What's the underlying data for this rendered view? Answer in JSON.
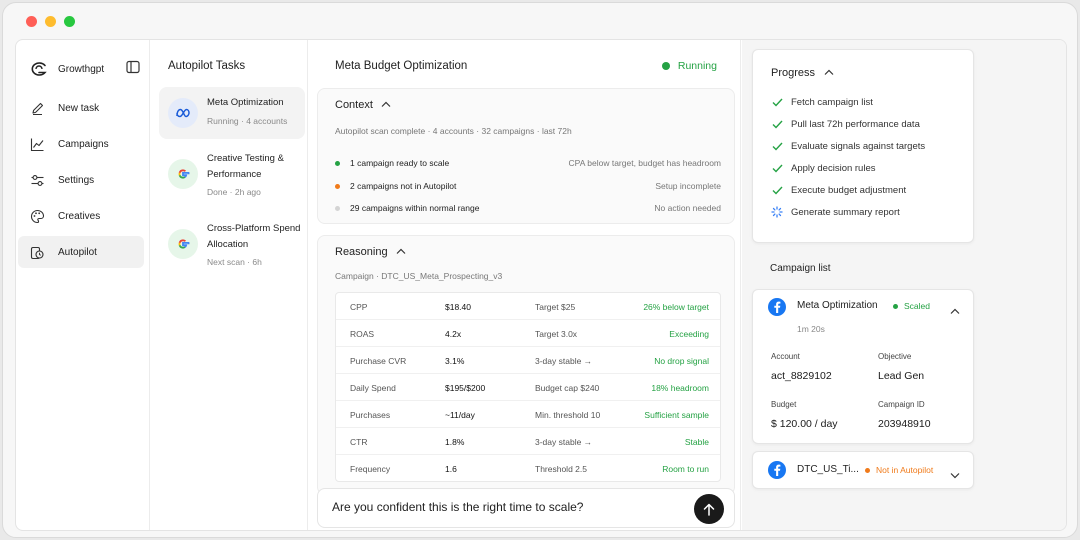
{
  "window": {
    "controls": {
      "close_color": "#ff5f57",
      "minimize_color": "#febc2e",
      "zoom_color": "#28c840"
    }
  },
  "sidebar": {
    "brand": "Growthgpt",
    "items": [
      {
        "label": "New task",
        "icon": "pen-icon"
      },
      {
        "label": "Campaigns",
        "icon": "line-chart-icon"
      },
      {
        "label": "Settings",
        "icon": "sliders-icon"
      },
      {
        "label": "Creatives",
        "icon": "palette-icon"
      },
      {
        "label": "Autopilot",
        "icon": "autopilot-icon",
        "active": true
      }
    ]
  },
  "tasks": {
    "title": "Autopilot Tasks",
    "items": [
      {
        "title": "Meta Optimization",
        "subtitle": "Running · 4 accounts",
        "icon": "meta-icon",
        "active": true
      },
      {
        "title": "Creative Testing & Performance",
        "subtitle": "Done · 2h ago",
        "icon": "google-icon"
      },
      {
        "title": "Cross-Platform Spend Allocation",
        "subtitle": "Next scan · 6h",
        "icon": "google-icon"
      }
    ]
  },
  "main": {
    "title": "Meta Budget Optimization",
    "status": "Running",
    "context": {
      "title": "Context",
      "summary": "Autopilot scan complete · 4 accounts · 32 campaigns · last 72h",
      "rows": [
        {
          "label": "1 campaign ready to scale",
          "detail": "CPA below target, budget has headroom",
          "color": "#25a244"
        },
        {
          "label": "2 campaigns not in Autopilot",
          "detail": "Setup incomplete",
          "color": "#f07a1a"
        },
        {
          "label": "29 campaigns within normal range",
          "detail": "No action needed",
          "color": "#d4d4d4"
        }
      ]
    },
    "reasoning": {
      "title": "Reasoning",
      "campaign": "Campaign · DTC_US_Meta_Prospecting_v3",
      "rows": [
        {
          "metric": "CPP",
          "value": "$18.40",
          "reference": "Target $25",
          "note": "26% below target"
        },
        {
          "metric": "ROAS",
          "value": "4.2x",
          "reference": "Target 3.0x",
          "note": "Exceeding"
        },
        {
          "metric": "Purchase CVR",
          "value": "3.1%",
          "reference": "3-day stable →",
          "note": "No drop signal"
        },
        {
          "metric": "Daily Spend",
          "value": "$195/$200",
          "reference": "Budget cap $240",
          "note": "18% headroom"
        },
        {
          "metric": "Purchases",
          "value": "~11/day",
          "reference": "Min. threshold 10",
          "note": "Sufficient sample"
        },
        {
          "metric": "CTR",
          "value": "1.8%",
          "reference": "3-day stable →",
          "note": "Stable"
        },
        {
          "metric": "Frequency",
          "value": "1.6",
          "reference": "Threshold 2.5",
          "note": "Room to run"
        }
      ]
    },
    "ask": {
      "value": "Are you confident this is the right time to scale?"
    }
  },
  "progress": {
    "title": "Progress",
    "steps": [
      {
        "label": "Fetch campaign list",
        "state": "done"
      },
      {
        "label": "Pull last 72h performance data",
        "state": "done"
      },
      {
        "label": "Evaluate signals against targets",
        "state": "done"
      },
      {
        "label": "Apply decision rules",
        "state": "done"
      },
      {
        "label": "Execute budget adjustment",
        "state": "done"
      },
      {
        "label": "Generate summary report",
        "state": "in-progress"
      }
    ]
  },
  "campaign_list": {
    "title": "Campaign list",
    "items": [
      {
        "name": "Meta Optimization",
        "status": "Scaled",
        "status_color": "#25a244",
        "time": "1m 20s",
        "fields": {
          "account_label": "Account",
          "account": "act_8829102",
          "objective_label": "Objective",
          "objective": "Lead Gen",
          "budget_label": "Budget",
          "budget": "$ 120.00 / day",
          "campaign_id_label": "Campaign ID",
          "campaign_id": "203948910"
        }
      },
      {
        "name": "DTC_US_Ti...",
        "status": "Not in Autopilot",
        "status_color": "#f07a1a"
      }
    ]
  }
}
